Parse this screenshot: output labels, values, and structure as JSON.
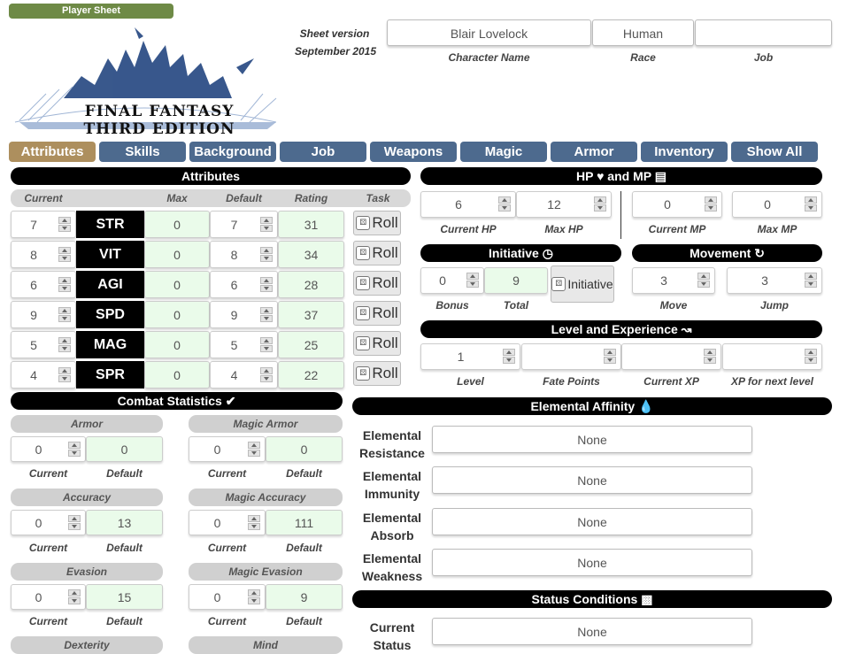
{
  "header": {
    "badge": "Player Sheet",
    "logo_text": "FINAL FANTASY THIRD EDITION",
    "sheet_version_label": "Sheet version",
    "sheet_version_date": "September 2015"
  },
  "character": {
    "name": "Blair Lovelock",
    "race": "Human",
    "job": "",
    "name_label": "Character Name",
    "race_label": "Race",
    "job_label": "Job"
  },
  "tabs": [
    "Attributes",
    "Skills",
    "Background",
    "Job",
    "Weapons",
    "Magic",
    "Armor",
    "Inventory",
    "Show All"
  ],
  "attributes": {
    "title": "Attributes",
    "headers": [
      "Current",
      "Max",
      "Default",
      "Rating",
      "Task"
    ],
    "roll_label": "Roll",
    "rows": [
      {
        "current": "7",
        "name": "STR",
        "max": "0",
        "default": "7",
        "rating": "31"
      },
      {
        "current": "8",
        "name": "VIT",
        "max": "0",
        "default": "8",
        "rating": "34"
      },
      {
        "current": "6",
        "name": "AGI",
        "max": "0",
        "default": "6",
        "rating": "28"
      },
      {
        "current": "9",
        "name": "SPD",
        "max": "0",
        "default": "9",
        "rating": "37"
      },
      {
        "current": "5",
        "name": "MAG",
        "max": "0",
        "default": "5",
        "rating": "25"
      },
      {
        "current": "4",
        "name": "SPR",
        "max": "0",
        "default": "4",
        "rating": "22"
      }
    ]
  },
  "hpmp": {
    "title": "HP ♥ and MP",
    "current_hp": "6",
    "max_hp": "12",
    "current_mp": "0",
    "max_mp": "0",
    "labels": [
      "Current HP",
      "Max HP",
      "Current MP",
      "Max MP"
    ]
  },
  "initiative": {
    "title": "Initiative",
    "bonus": "0",
    "total": "9",
    "button": "Initiative",
    "labels": [
      "Bonus",
      "Total"
    ]
  },
  "movement": {
    "title": "Movement",
    "move": "3",
    "jump": "3",
    "labels": [
      "Move",
      "Jump"
    ]
  },
  "level": {
    "title": "Level and Experience",
    "level": "1",
    "fate_points": "",
    "current_xp": "",
    "xp_next": "",
    "labels": [
      "Level",
      "Fate Points",
      "Current XP",
      "XP for next level"
    ]
  },
  "combat": {
    "title": "Combat Statistics",
    "current_label": "Current",
    "default_label": "Default",
    "stats": [
      {
        "name": "Armor",
        "current": "0",
        "default": "0"
      },
      {
        "name": "Magic Armor",
        "current": "0",
        "default": "0"
      },
      {
        "name": "Accuracy",
        "current": "0",
        "default": "13"
      },
      {
        "name": "Magic Accuracy",
        "current": "0",
        "default": "111"
      },
      {
        "name": "Evasion",
        "current": "0",
        "default": "15"
      },
      {
        "name": "Magic Evasion",
        "current": "0",
        "default": "9"
      },
      {
        "name": "Dexterity",
        "current": "",
        "default": ""
      },
      {
        "name": "Mind",
        "current": "",
        "default": ""
      }
    ]
  },
  "elemental": {
    "title": "Elemental Affinity",
    "rows": [
      {
        "label1": "Elemental",
        "label2": "Resistance",
        "value": "None"
      },
      {
        "label1": "Elemental",
        "label2": "Immunity",
        "value": "None"
      },
      {
        "label1": "Elemental",
        "label2": "Absorb",
        "value": "None"
      },
      {
        "label1": "Elemental",
        "label2": "Weakness",
        "value": "None"
      }
    ]
  },
  "status": {
    "title": "Status Conditions",
    "label1": "Current",
    "label2": "Status",
    "value": "None"
  }
}
